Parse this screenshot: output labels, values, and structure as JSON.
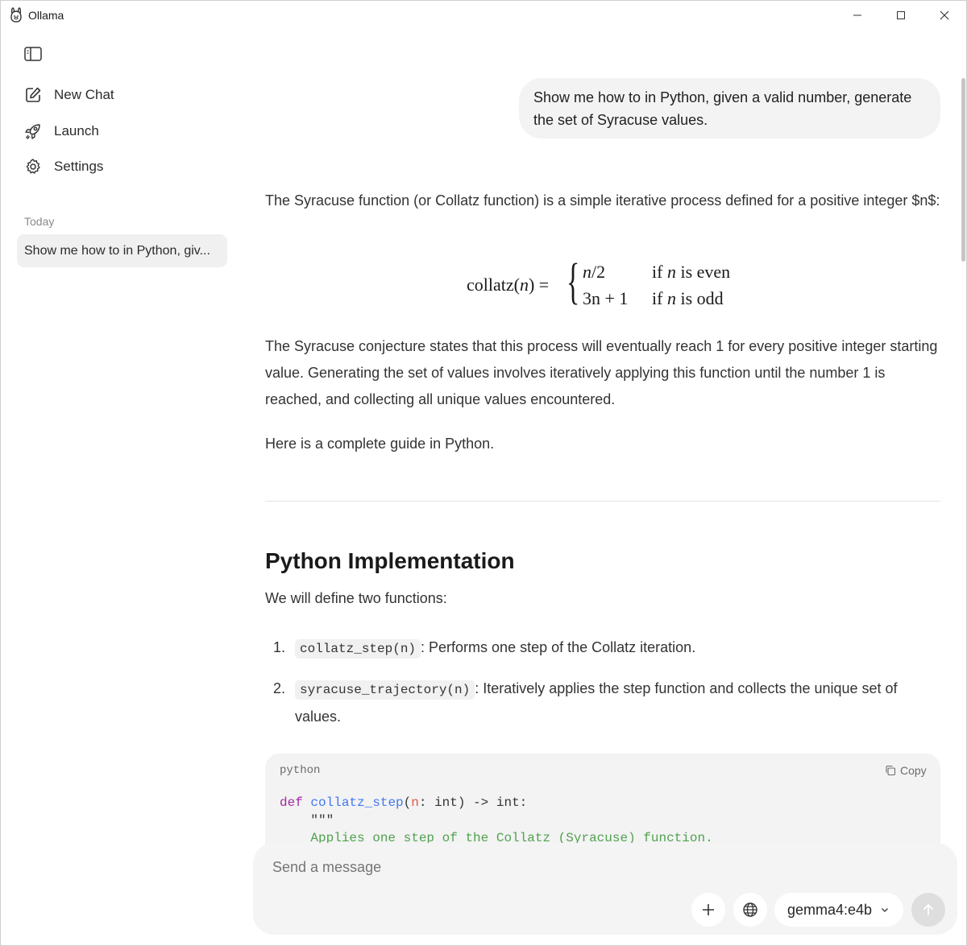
{
  "app": {
    "title": "Ollama"
  },
  "window_controls": {
    "minimize_icon": "minimize-icon",
    "maximize_icon": "maximize-icon",
    "close_icon": "close-icon"
  },
  "sidebar": {
    "toggle_icon": "sidebar-toggle-icon",
    "items": [
      {
        "label": "New Chat",
        "icon": "edit-icon"
      },
      {
        "label": "Launch",
        "icon": "rocket-icon"
      },
      {
        "label": "Settings",
        "icon": "gear-icon"
      }
    ],
    "section_label": "Today",
    "chats": [
      {
        "title": "Show me how to in Python, giv..."
      }
    ]
  },
  "conversation": {
    "user_message": "Show me how to in Python, given a valid number, generate the set of Syracuse values.",
    "intro": "The Syracuse function (or Collatz function) is a simple iterative process defined for a positive integer $n$:",
    "formula": {
      "lhs": "collatz(n) =",
      "rows": [
        {
          "expr": "n/2",
          "cond": "if n is even"
        },
        {
          "expr": "3n + 1",
          "cond": "if n is odd"
        }
      ]
    },
    "conjecture": "The Syracuse conjecture states that this process will eventually reach 1 for every positive integer starting value. Generating the set of values involves iteratively applying this function until the number 1 is reached, and collecting all unique values encountered.",
    "guide_intro": "Here is a complete guide in Python.",
    "heading": "Python Implementation",
    "define_intro": "We will define two functions:",
    "list": [
      {
        "num": "1.",
        "code": "collatz_step(n)",
        "text": ": Performs one step of the Collatz iteration."
      },
      {
        "num": "2.",
        "code": "syracuse_trajectory(n)",
        "text": ": Iteratively applies the step function and collects the unique set of values."
      }
    ],
    "code_block": {
      "language": "python",
      "copy_label": "Copy",
      "line1": {
        "kw": "def",
        "fn": "collatz_step",
        "open": "(",
        "param": "n",
        "rest": ": int) -> int:"
      },
      "line2": "    \"\"\"",
      "line3": "    Applies one step of the Collatz (Syracuse) function."
    }
  },
  "composer": {
    "placeholder": "Send a message",
    "model": "gemma4:e4b",
    "add_icon": "plus-icon",
    "web_icon": "globe-icon",
    "send_icon": "arrow-up-icon"
  }
}
